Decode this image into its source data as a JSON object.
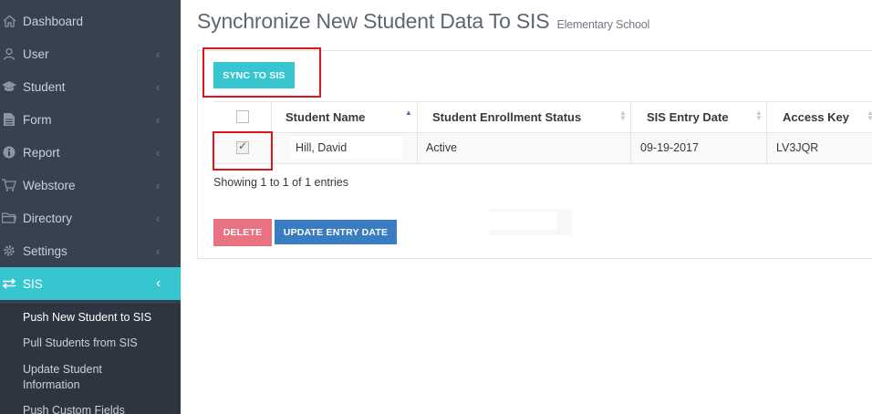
{
  "sidebar": {
    "items": [
      {
        "label": "Dashboard",
        "icon": "home-icon"
      },
      {
        "label": "User",
        "icon": "user-icon"
      },
      {
        "label": "Student",
        "icon": "graduation-cap-icon"
      },
      {
        "label": "Form",
        "icon": "file-icon"
      },
      {
        "label": "Report",
        "icon": "info-icon"
      },
      {
        "label": "Webstore",
        "icon": "cart-icon"
      },
      {
        "label": "Directory",
        "icon": "folder-icon"
      },
      {
        "label": "Settings",
        "icon": "gear-icon"
      },
      {
        "label": "SIS",
        "icon": "exchange-icon",
        "active": true
      }
    ],
    "submenu": [
      {
        "label": "Push New Student to SIS",
        "active": true
      },
      {
        "label": "Pull Students from SIS"
      },
      {
        "label": "Update Student Information"
      },
      {
        "label": "Push Custom Fields"
      }
    ],
    "active_color": "#37c6d0",
    "bg_color": "#37424f"
  },
  "page": {
    "title": "Synchronize New Student Data To SIS",
    "subtitle": "Elementary School"
  },
  "toolbar": {
    "sync_label": "SYNC TO SIS"
  },
  "table": {
    "columns": [
      "Student Name",
      "Student Enrollment Status",
      "SIS Entry Date",
      "Access Key"
    ],
    "rows": [
      {
        "checked": true,
        "name": "Hill, David",
        "status": "Active",
        "entry_date": "09-19-2017",
        "access_key": "LV3JQR"
      }
    ],
    "info": "Showing 1 to 1 of 1 entries"
  },
  "actions": {
    "delete_label": "DELETE",
    "update_label": "UPDATE ENTRY DATE"
  },
  "colors": {
    "highlight": "#e0141e",
    "delete": "#e8727f",
    "update": "#3a7cc2"
  }
}
